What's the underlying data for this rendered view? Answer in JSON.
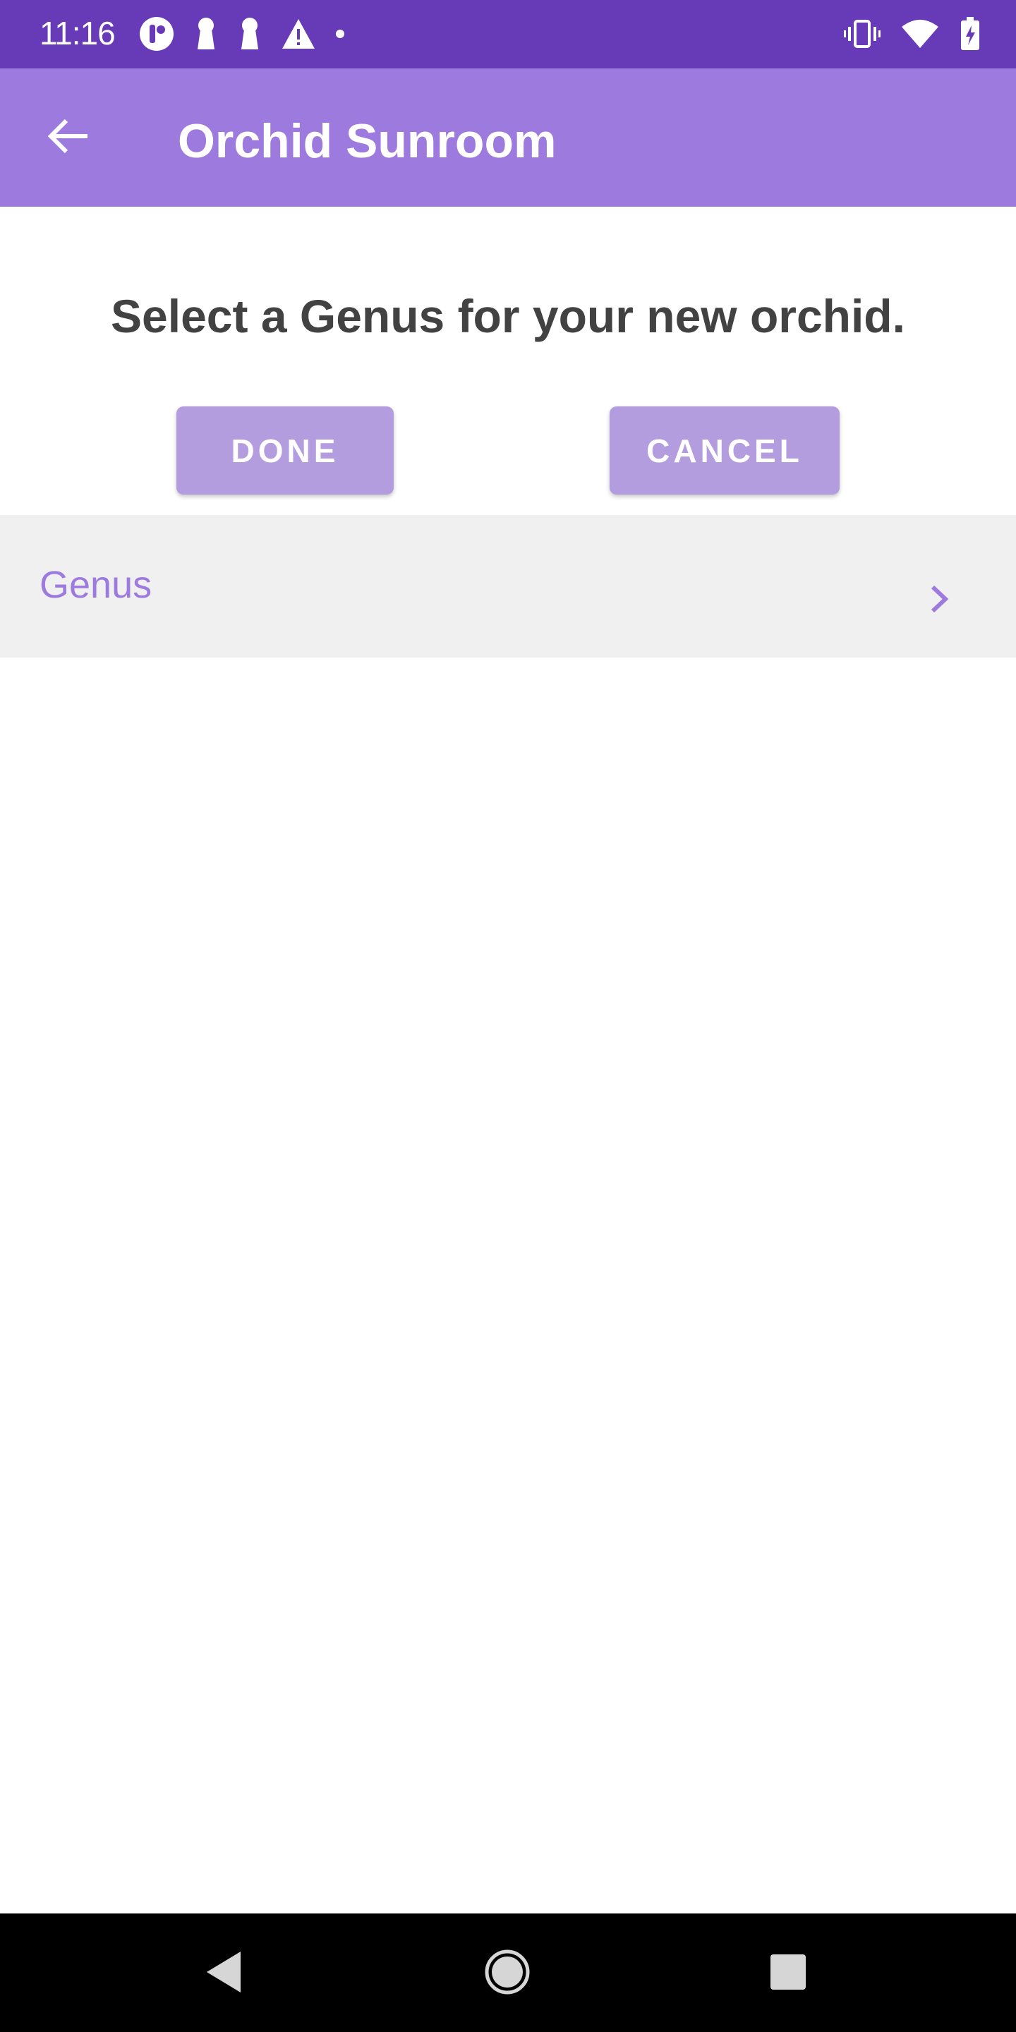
{
  "status_bar": {
    "time": "11:16",
    "left_icons": [
      "app-notification-icon",
      "keyhole-icon",
      "keyhole-icon",
      "warning-icon",
      "dot-icon"
    ],
    "right_icons": [
      "vibrate-icon",
      "wifi-icon",
      "battery-charging-icon"
    ]
  },
  "app_bar": {
    "title": "Orchid Sunroom",
    "back_icon": "arrow-back-icon",
    "color": "#9c7ade"
  },
  "prompt": "Select a Genus for your new orchid.",
  "buttons": {
    "done": "DONE",
    "cancel": "CANCEL",
    "color": "#b39ddf"
  },
  "genus_row": {
    "label": "Genus",
    "chevron_icon": "chevron-right-icon"
  },
  "nav_bar": {
    "back_icon": "nav-back-icon",
    "home_icon": "nav-home-icon",
    "recents_icon": "nav-recents-icon"
  },
  "colors": {
    "status_bar": "#673ab7",
    "accent": "#9c7ade",
    "row_background": "#f0f0f0",
    "prompt_text": "#424242"
  }
}
